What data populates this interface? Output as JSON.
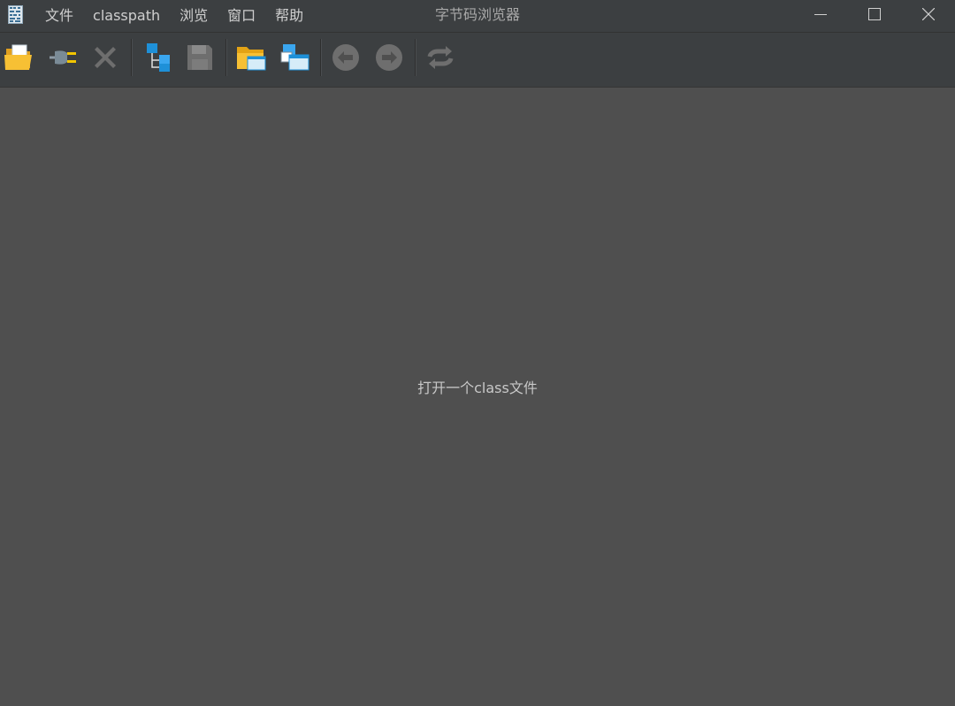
{
  "window": {
    "title": "字节码浏览器"
  },
  "menu": {
    "items": [
      {
        "label": "文件"
      },
      {
        "label": "classpath"
      },
      {
        "label": "浏览"
      },
      {
        "label": "窗口"
      },
      {
        "label": "帮助"
      }
    ]
  },
  "toolbar": {
    "buttons": [
      {
        "icon": "open-folder-icon",
        "enabled": true
      },
      {
        "icon": "plug-icon",
        "enabled": true
      },
      {
        "icon": "close-x-icon",
        "enabled": false
      },
      {
        "icon": "hierarchy-icon",
        "enabled": true
      },
      {
        "icon": "floppy-save-icon",
        "enabled": false
      },
      {
        "icon": "open-window-folder-icon",
        "enabled": true
      },
      {
        "icon": "open-window-icon",
        "enabled": true
      },
      {
        "icon": "back-arrow-icon",
        "enabled": false
      },
      {
        "icon": "forward-arrow-icon",
        "enabled": false
      },
      {
        "icon": "reload-icon",
        "enabled": false
      }
    ]
  },
  "content": {
    "placeholder": "打开一个class文件"
  },
  "colors": {
    "background": "#4f4f4f",
    "bar": "#3c3f41",
    "text": "#cfcfcf",
    "folder": "#f5b923",
    "blue": "#1e90d8"
  }
}
